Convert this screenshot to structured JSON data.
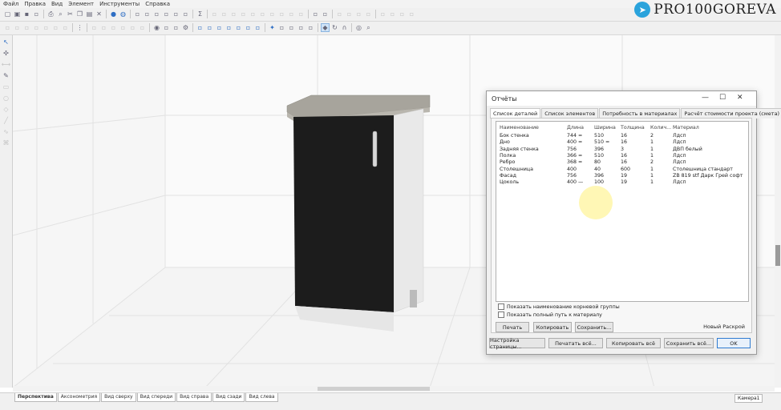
{
  "menu": [
    "Файл",
    "Правка",
    "Вид",
    "Элемент",
    "Инструменты",
    "Справка"
  ],
  "logo": {
    "text": "PRO100GOREVA",
    "icon": "telegram-icon",
    "color": "#2aa3dc"
  },
  "toolbar": {
    "row1_icons": [
      "new-icon",
      "open-icon",
      "save-icon",
      "save-as-icon",
      "print-icon",
      "print-preview-icon",
      "cut-icon",
      "copy-icon",
      "paste-icon",
      "delete-icon",
      "sphere-icon",
      "sphere-gray-icon",
      "properties-icon",
      "list-icon",
      "list2-icon",
      "list3-icon",
      "list4-icon",
      "report-icon",
      "sum-icon",
      "align-icon",
      "align2-icon",
      "align3-icon",
      "align4-icon",
      "align5-icon",
      "align6-icon",
      "align7-icon",
      "align8-icon",
      "align9-icon",
      "align10-icon",
      "grid-icon",
      "grid2-icon",
      "arrow-up-icon",
      "arrow-down-icon",
      "arrow-left-icon",
      "arrow-right-icon",
      "link-icon",
      "unlink-icon",
      "rotate-icon",
      "rotate2-icon"
    ],
    "row2_icons": [
      "move-icon",
      "move2-icon",
      "move3-icon",
      "move4-icon",
      "move5-icon",
      "move6-icon",
      "move7-icon",
      "grid-dots-icon",
      "snap-icon",
      "snap2-icon",
      "snap3-icon",
      "snap4-icon",
      "snap5-icon",
      "snap6-icon",
      "eye-icon",
      "eye2-icon",
      "eye3-icon",
      "gear-icon",
      "view-cube-icon",
      "view-cube2-icon",
      "view-cube3-icon",
      "view-cube4-icon",
      "view-cube5-icon",
      "view-cube6-icon",
      "view-cube7-icon",
      "light-icon",
      "light2-icon",
      "pin-icon",
      "grid-view-icon",
      "shadow-icon",
      "diamond-icon",
      "refresh-icon",
      "magnet-icon",
      "target-icon",
      "search-icon"
    ],
    "zoom": ""
  },
  "view_tabs": [
    "Перспектива",
    "Аксонометрия",
    "Вид сверху",
    "Вид спереди",
    "Вид справа",
    "Вид сзади",
    "Вид слева"
  ],
  "camera_tab": "Камера1",
  "dialog": {
    "title": "Отчёты",
    "tabs": [
      "Список деталей",
      "Список элементов",
      "Потребность в материалах",
      "Расчёт стоимости проекта (смета)"
    ],
    "active_tab": 0,
    "columns": [
      "Наименование",
      "Длина",
      "Ширина",
      "Толщина",
      "Колич...",
      "Материал"
    ],
    "rows": [
      [
        "Бок стенка",
        "744 =",
        "510",
        "16",
        "2",
        "Лдсп"
      ],
      [
        "Дно",
        "400 =",
        "510 =",
        "16",
        "1",
        "Лдсп"
      ],
      [
        "Задняя стенка",
        "756",
        "396",
        "3",
        "1",
        "ДВП белый"
      ],
      [
        "Полка",
        "366 =",
        "510",
        "16",
        "1",
        "Лдсп"
      ],
      [
        "Ребро",
        "368 =",
        "80",
        "16",
        "2",
        "Лдсп"
      ],
      [
        "Столешница",
        "400",
        "40",
        "600",
        "1",
        "Столешница стандарт"
      ],
      [
        "Фасад",
        "756",
        "396",
        "19",
        "1",
        "ZB 819 stf Дарк Грей софт"
      ],
      [
        "Цоколь",
        "400 —",
        "100",
        "19",
        "1",
        "Лдсп"
      ]
    ],
    "check1": "Показать наименование корневой группы",
    "check2": "Показать полный путь к материалу",
    "btn_print": "Печать",
    "btn_copy": "Копировать",
    "btn_save": "Сохранить...",
    "new_cut": "Новый Раскрой",
    "btn_page_setup": "Настройка страницы...",
    "btn_print_all": "Печатать всё...",
    "btn_copy_all": "Копировать всё",
    "btn_save_all": "Сохранить всё...",
    "btn_ok": "OK"
  }
}
